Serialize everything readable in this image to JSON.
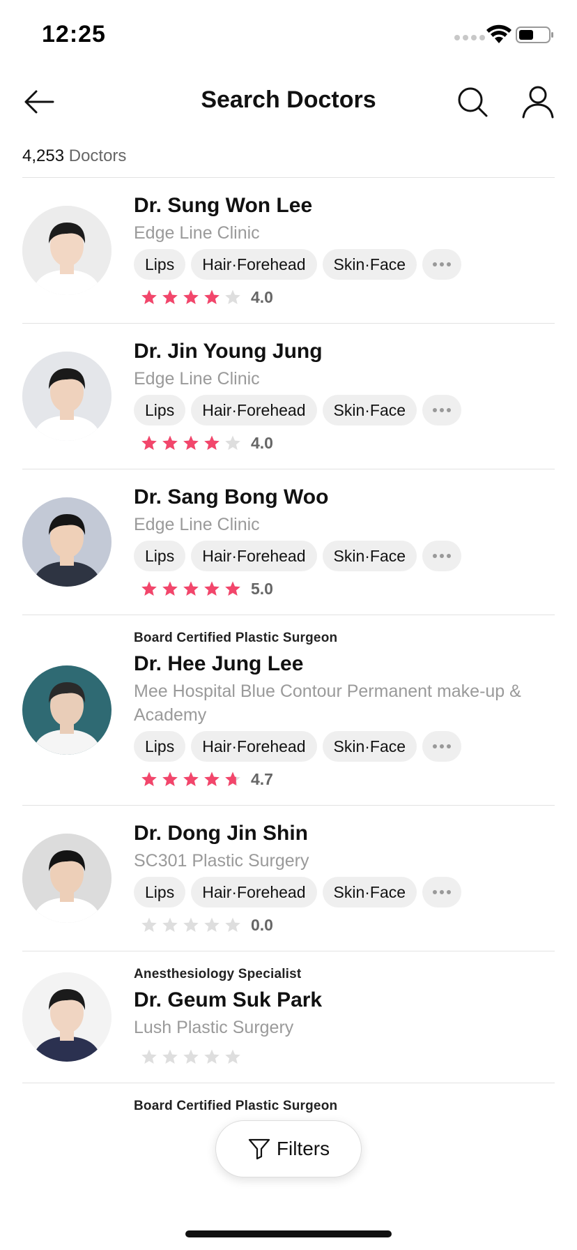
{
  "status_bar": {
    "time": "12:25"
  },
  "header": {
    "title": "Search Doctors"
  },
  "results": {
    "count": "4,253",
    "label": " Doctors"
  },
  "tag_more_icon": "more-horizontal-icon",
  "colors": {
    "star_filled": "#f2466b",
    "star_empty": "#dedede",
    "tag_bg": "#efefef"
  },
  "doctors": [
    {
      "specialty": "",
      "name": "Dr. Sung Won Lee",
      "clinic": "Edge Line Clinic",
      "tags": [
        "Lips",
        "Hair·Forehead",
        "Skin·Face"
      ],
      "rating": 4.0,
      "rating_text": "4.0"
    },
    {
      "specialty": "",
      "name": "Dr. Jin Young Jung",
      "clinic": "Edge Line Clinic",
      "tags": [
        "Lips",
        "Hair·Forehead",
        "Skin·Face"
      ],
      "rating": 4.0,
      "rating_text": "4.0"
    },
    {
      "specialty": "",
      "name": "Dr. Sang Bong Woo",
      "clinic": "Edge Line Clinic",
      "tags": [
        "Lips",
        "Hair·Forehead",
        "Skin·Face"
      ],
      "rating": 5.0,
      "rating_text": "5.0"
    },
    {
      "specialty": "Board Certified Plastic Surgeon",
      "name": "Dr. Hee Jung Lee",
      "clinic": "Mee Hospital Blue Contour Permanent make-up & Academy",
      "tags": [
        "Lips",
        "Hair·Forehead",
        "Skin·Face"
      ],
      "rating": 4.7,
      "rating_text": "4.7"
    },
    {
      "specialty": "",
      "name": "Dr. Dong Jin Shin",
      "clinic": "SC301 Plastic Surgery",
      "tags": [
        "Lips",
        "Hair·Forehead",
        "Skin·Face"
      ],
      "rating": 0.0,
      "rating_text": "0.0"
    },
    {
      "specialty": "Anesthesiology Specialist",
      "name": "Dr. Geum Suk Park",
      "clinic": "Lush Plastic Surgery",
      "tags": [],
      "rating": 0.0,
      "rating_text": ""
    },
    {
      "specialty": "Board Certified Plastic Surgeon",
      "name": "",
      "clinic": "",
      "tags": [],
      "rating": null,
      "rating_text": ""
    }
  ],
  "filters_button": {
    "label": "Filters",
    "icon": "filter-funnel-icon"
  }
}
